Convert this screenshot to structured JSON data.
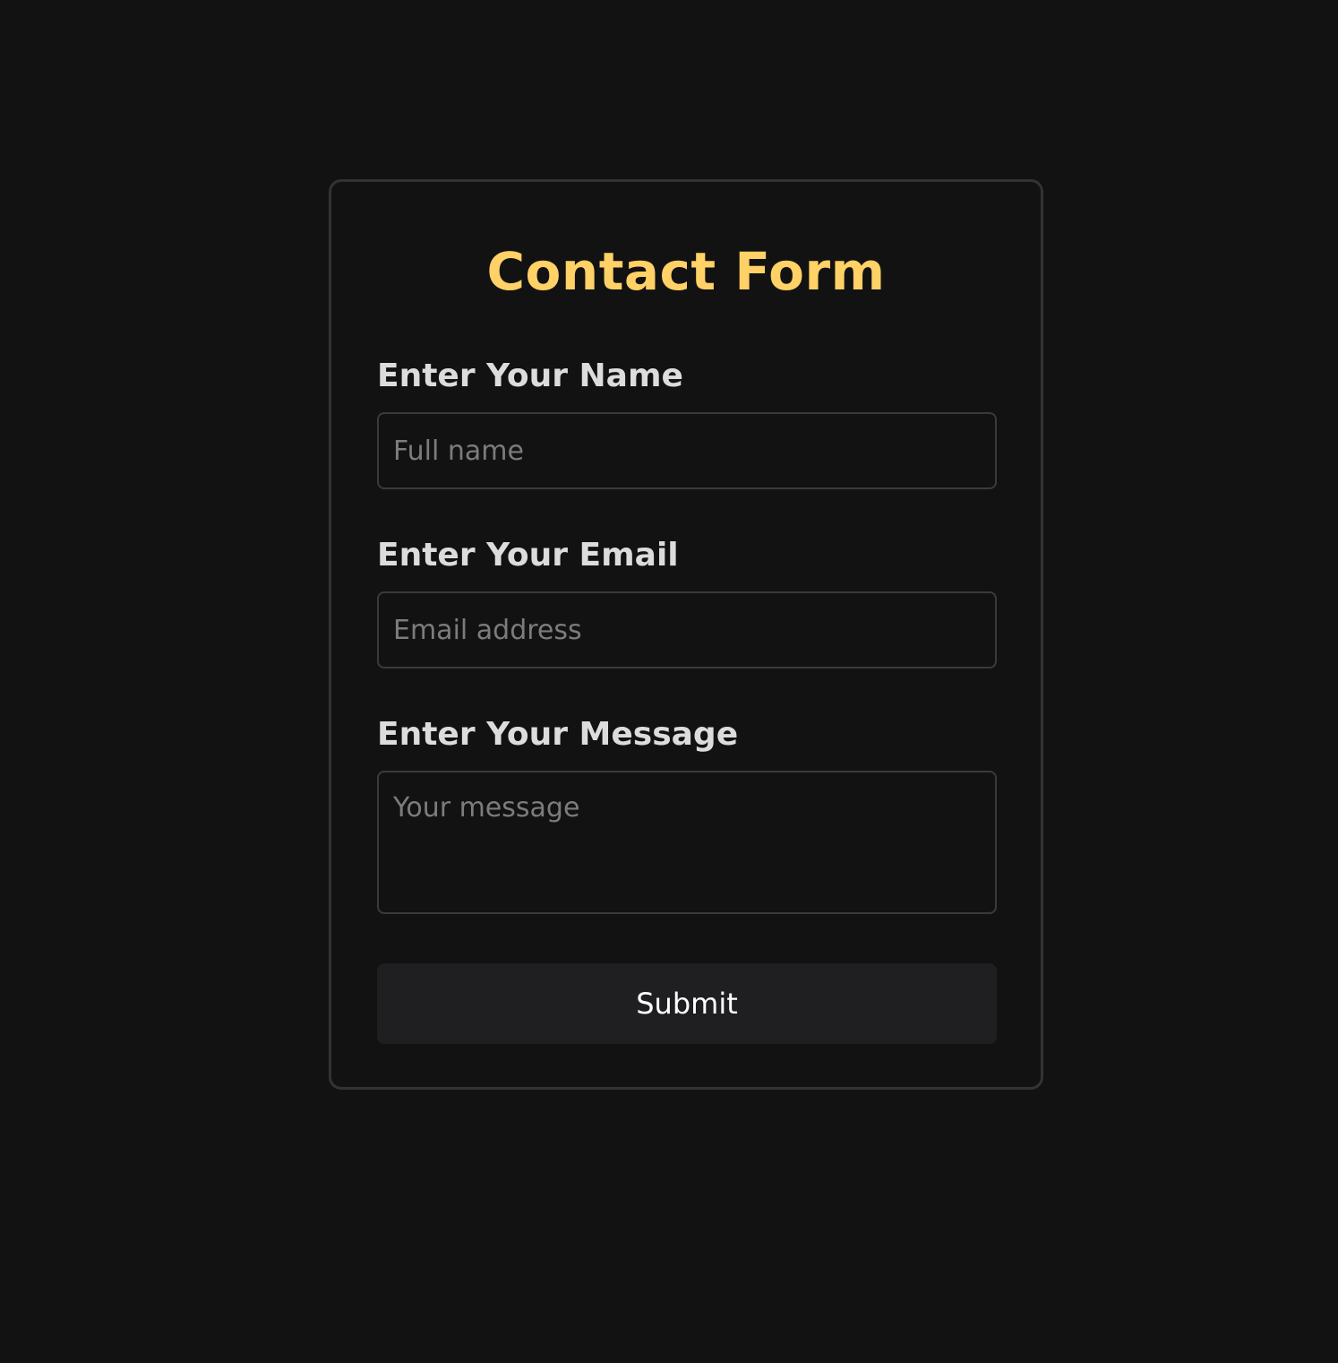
{
  "form": {
    "title": "Contact Form",
    "name_label": "Enter Your Name",
    "name_placeholder": "Full name",
    "email_label": "Enter Your Email",
    "email_placeholder": "Email address",
    "message_label": "Enter Your Message",
    "message_placeholder": "Your message",
    "submit_label": "Submit"
  },
  "colors": {
    "background": "#121212",
    "title_accent": "#ffd166",
    "label": "#dcdcdc",
    "border": "#333333",
    "button_bg": "#1f1f21"
  }
}
